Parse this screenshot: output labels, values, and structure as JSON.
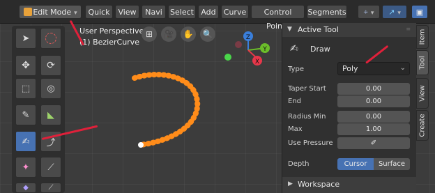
{
  "header": {
    "mode_label": "Edit Mode",
    "menus": [
      "Quick",
      "View",
      "Navi",
      "Select",
      "Add",
      "Curve",
      "Control Points",
      "Segments"
    ]
  },
  "viewport": {
    "perspective_label": "User Perspective",
    "object_label": "(1) BezierCurve",
    "gizmo": {
      "z": "Z",
      "y": "Y",
      "x": "X"
    }
  },
  "tool_panel": {
    "title": "Active Tool",
    "tool_name": "Draw",
    "type_label": "Type",
    "type_value": "Poly",
    "taper_start_label": "Taper Start",
    "taper_start_value": "0.00",
    "end_label": "End",
    "end_value": "0.00",
    "radius_min_label": "Radius Min",
    "radius_min_value": "0.00",
    "max_label": "Max",
    "max_value": "1.00",
    "use_pressure_label": "Use Pressure",
    "depth_label": "Depth",
    "depth_options": [
      "Cursor",
      "Surface"
    ],
    "workspace_label": "Workspace"
  },
  "tabs": [
    "Item",
    "Tool",
    "View",
    "Create"
  ],
  "colors": {
    "accent": "#4772b3",
    "stroke": "#ff8c1a",
    "annotation": "#e0203a",
    "axis_x": "#e8374a",
    "axis_y": "#6bbd2a",
    "axis_z": "#3a7fdb"
  }
}
